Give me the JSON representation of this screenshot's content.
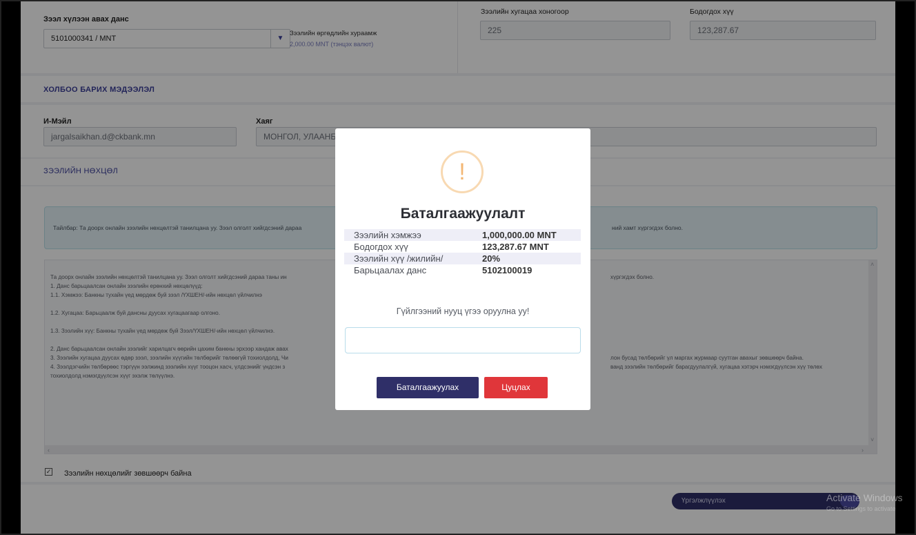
{
  "loan_form": {
    "account_label": "Зээл хүлээн авах данс",
    "account_value": "5101000341 / MNT",
    "fee_label": "Зээлийн өргөдлийн хураамж",
    "fee_value": "2,000.00 MNT (тэнцэх валют)",
    "term_label": "Зээлийн хугацаа хоногоор",
    "term_value": "225",
    "interest_calc_label": "Бодогдох хүү",
    "interest_calc_value": "123,287.67"
  },
  "contact": {
    "section_title": "ХОЛБОО БАРИХ МЭДЭЭЛЭЛ",
    "email_label": "И-Мэйл",
    "email_value": "jargalsaikhan.d@ckbank.mn",
    "address_label": "Хаяг",
    "address_value": "МОНГОЛ, УЛААНБ"
  },
  "terms": {
    "section_title": "ЗЭЭЛИЙН НӨХЦӨЛ",
    "note_left": "Тайлбар: Та доорх онлайн зээлийн нөхцөлтэй танилцана уу. Зээл олголт хийгдсэний дараа",
    "note_right": "ний хамт хүргэгдэх болно.",
    "lines": [
      "Та доорх онлайн зээлийн нөхцөлтэй танилцана уу. Зээл олголт хийгдсэний дараа таны ин",
      "1. Данс барьцаалсан онлайн зээлийн ерөнхий нөхцөлүүд:",
      "1.1. Хэмжээ: Банкны тухайн үед мөрдөж буй зээл /ҮХШЕН/-ийн нөхцөл үйлчилнэ",
      "",
      "1.2. Хугацаа: Барьцаалж буй дансны дуусах хугацаагаар олгоно.",
      "",
      "1.3. Зээлийн хүү: Банкны тухайн үед мөрдөж буй Зээл/ҮХШЕН/-ийн нөхцөл үйлчилнэ.",
      "",
      "2. Данс барьцаалсан онлайн зээлийг харилцагч өөрийн цахим банкны эрхээр хандаж авах",
      "3. Зээлийн хугацаа дуусах өдөр зээл, зээлийн хүүгийн төлбөрийг төлөөгүй тохиолдолд, Чи",
      "4. Зээлдэгчийн төлбөрөөс тэргүүн ээлжинд зээлийн хүүг тооцон хасч, үлдсэнийг үндсэн з",
      "тохиолдолд нэмэгдүүлсэн хүүг эхэлж төлүүлнэ."
    ],
    "lines_right": [
      "хүргэгдэх болно.",
      "",
      "",
      "",
      "",
      "",
      "",
      "",
      "",
      "лон бусад төлбөрийг үл маргах журмаар суутган авахыг зөвшөөрч байна.",
      "ванд зээлийн төлбөрийг барагдуулалгүй, хугацаа хэтэрч нэмэгдүүлсэн хүү төлөх",
      ""
    ],
    "agree_label": "Зээлийн нөхцөлийг зөвшөөрч байна",
    "continue_label": "Үргэлжлүүлэх"
  },
  "modal": {
    "icon": "exclamation-icon",
    "title": "Баталгаажуулалт",
    "rows": [
      {
        "key": "Зээлийн хэмжээ",
        "value": "1,000,000.00 MNT"
      },
      {
        "key": "Бодогдох хүү",
        "value": "123,287.67 MNT"
      },
      {
        "key": "Зээлийн хүү /жилийн/",
        "value": "20%"
      },
      {
        "key": "Барьцаалах данс",
        "value": "5102100019"
      }
    ],
    "prompt": "Гүйлгээний нууц үгээ оруулна уу!",
    "password_value": "",
    "confirm_label": "Баталгаажуулах",
    "cancel_label": "Цуцлах"
  },
  "watermark": {
    "line1": "Activate Windows",
    "line2": "Go to Settings to activate"
  },
  "colors": {
    "accent": "#2f2f68",
    "danger": "#e0363a",
    "warning": "#f3b774"
  }
}
